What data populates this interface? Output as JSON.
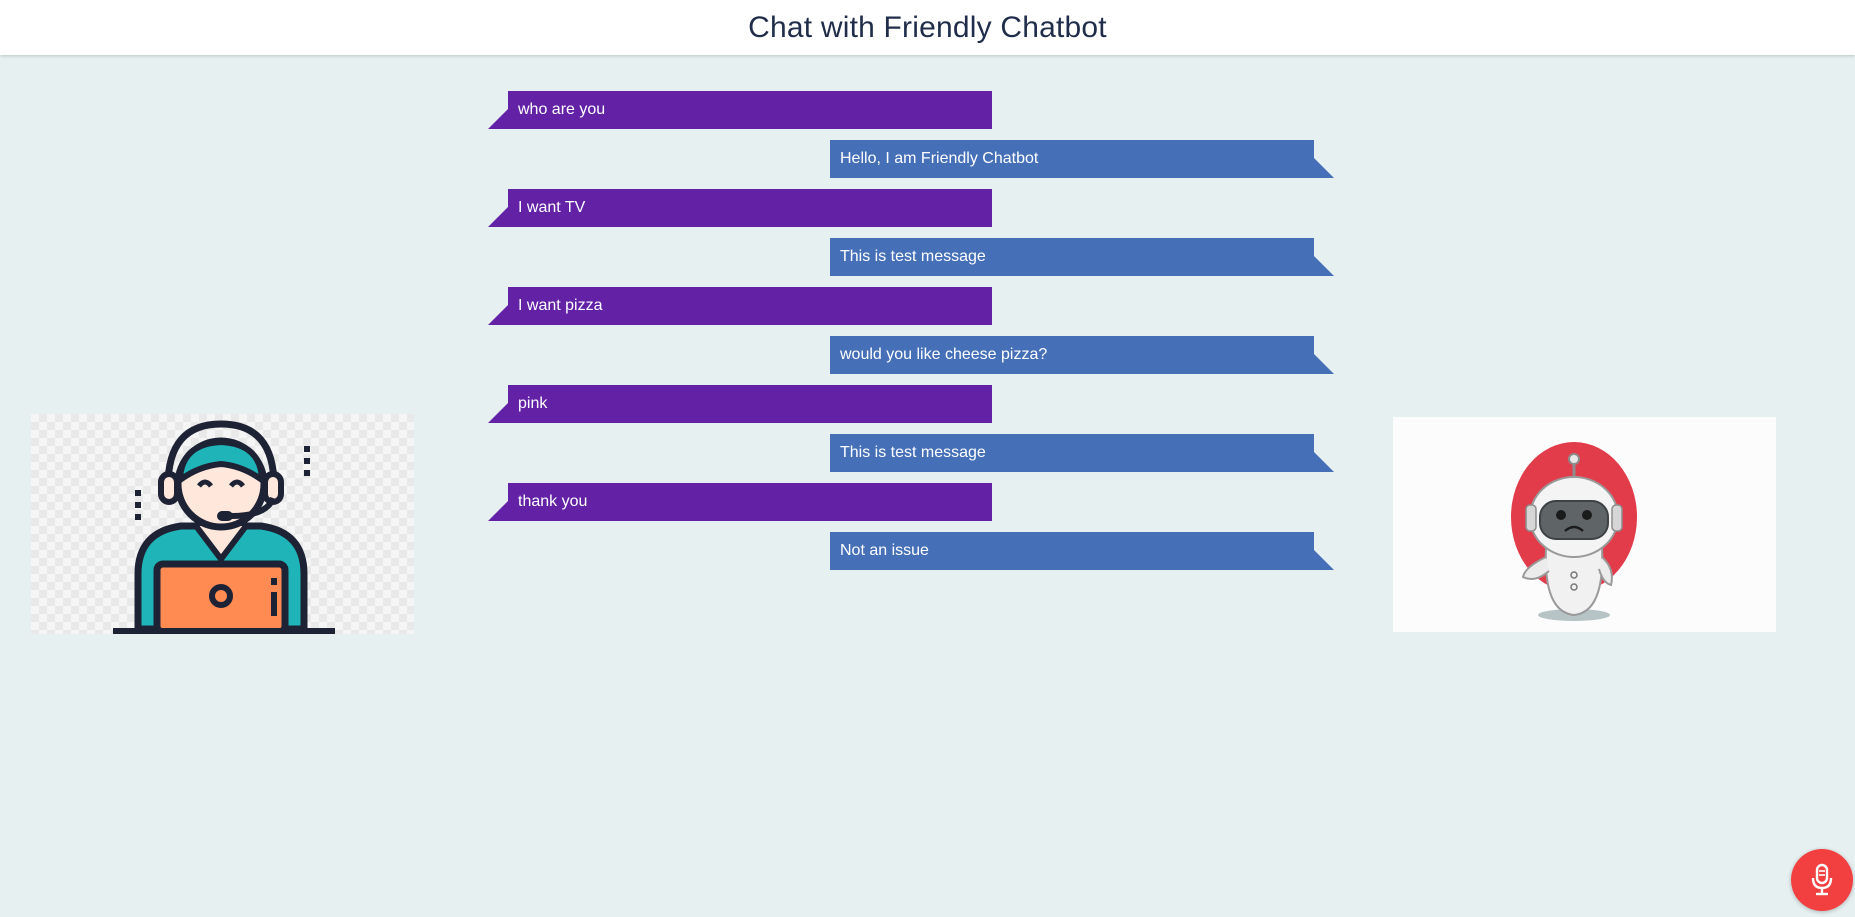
{
  "header": {
    "title": "Chat with Friendly Chatbot"
  },
  "messages": [
    {
      "sender": "user",
      "text": "who are you"
    },
    {
      "sender": "bot",
      "text": "Hello, I am Friendly Chatbot"
    },
    {
      "sender": "user",
      "text": "I want TV"
    },
    {
      "sender": "bot",
      "text": "This is test message"
    },
    {
      "sender": "user",
      "text": "I want pizza"
    },
    {
      "sender": "bot",
      "text": "would you like cheese pizza?"
    },
    {
      "sender": "user",
      "text": "pink"
    },
    {
      "sender": "bot",
      "text": "This is test message"
    },
    {
      "sender": "user",
      "text": "thank you"
    },
    {
      "sender": "bot",
      "text": "Not an issue"
    }
  ],
  "avatars": {
    "user_icon": "customer-support-agent-icon",
    "bot_icon": "robot-icon"
  },
  "mic": {
    "icon": "microphone-icon"
  },
  "colors": {
    "user_bubble": "#6322a6",
    "bot_bubble": "#4570b8",
    "background": "#e6f0f0",
    "mic_button": "#f24040"
  }
}
